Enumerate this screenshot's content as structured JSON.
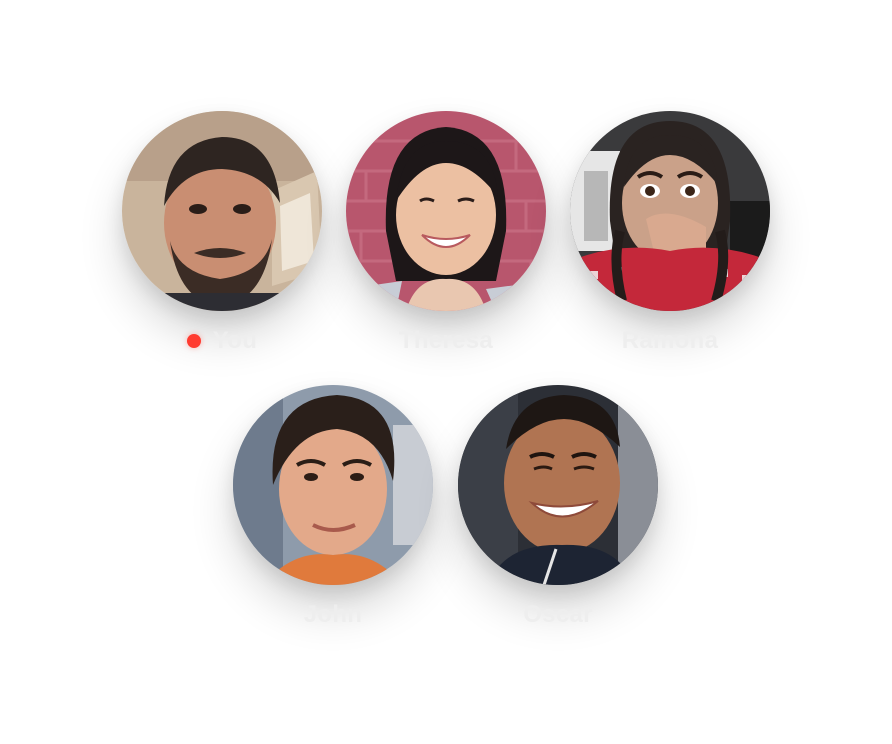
{
  "participants": [
    {
      "name": "You",
      "recording": true,
      "recording_color": "#ff3b30"
    },
    {
      "name": "Theresa",
      "recording": false
    },
    {
      "name": "Ramona",
      "recording": false
    },
    {
      "name": "John",
      "recording": false
    },
    {
      "name": "Oscar",
      "recording": false
    }
  ],
  "colors": {
    "name_text": "#eeeeee",
    "background": "#ffffff",
    "recording_dot": "#ff3b30"
  },
  "icons": {
    "recording": "recording-dot-icon"
  }
}
